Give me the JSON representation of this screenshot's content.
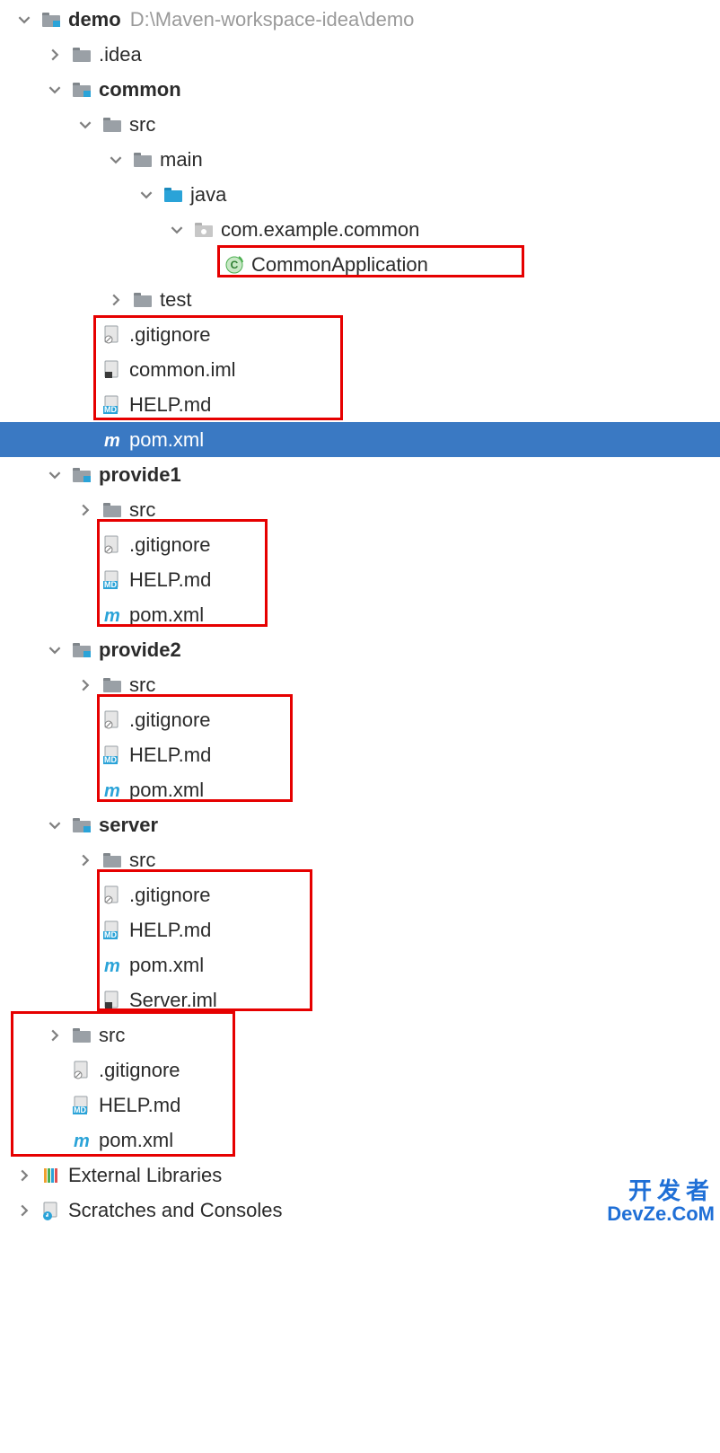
{
  "root": {
    "name": "demo",
    "path": "D:\\Maven-workspace-idea\\demo"
  },
  "nodes": {
    "idea": ".idea",
    "common": "common",
    "src": "src",
    "main": "main",
    "java": "java",
    "pkg_common": "com.example.common",
    "common_app": "CommonApplication",
    "test": "test",
    "gitignore": ".gitignore",
    "common_iml": "common.iml",
    "help_md": "HELP.md",
    "pom_xml": "pom.xml",
    "provide1": "provide1",
    "provide2": "provide2",
    "server": "server",
    "server_iml": "Server.iml",
    "external_libs": "External Libraries",
    "scratches": "Scratches and Consoles"
  },
  "watermark": {
    "line1": "开发者",
    "line2": "DevZe.CoM"
  }
}
